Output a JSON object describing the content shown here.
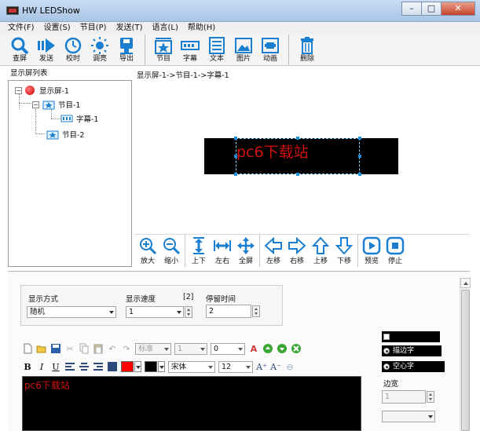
{
  "window": {
    "title": "HW LEDShow",
    "minimize": "–",
    "maximize": "□",
    "close": "✕"
  },
  "menu": [
    "文件(F)",
    "设置(S)",
    "节目(P)",
    "发送(T)",
    "语言(L)",
    "帮助(H)"
  ],
  "toolbar": {
    "groups": [
      [
        {
          "label": "查屏",
          "icon": "search-icon"
        },
        {
          "label": "发送",
          "icon": "send-icon"
        },
        {
          "label": "校时",
          "icon": "clock-icon"
        },
        {
          "label": "调亮",
          "icon": "brightness-icon"
        },
        {
          "label": "导出",
          "icon": "export-icon"
        }
      ],
      [
        {
          "label": "节目",
          "icon": "program-icon"
        },
        {
          "label": "字幕",
          "icon": "subtitle-icon"
        },
        {
          "label": "文本",
          "icon": "text-icon"
        },
        {
          "label": "图片",
          "icon": "image-icon"
        },
        {
          "label": "动画",
          "icon": "animation-icon"
        }
      ],
      [
        {
          "label": "删除",
          "icon": "delete-icon"
        }
      ]
    ]
  },
  "tree": {
    "header": "显示屏列表",
    "nodes": {
      "screen": "显示屏-1",
      "program1": "节目-1",
      "subtitle1": "字幕-1",
      "program2": "节目-2"
    }
  },
  "breadcrumb": "显示屏-1->节目-1->字幕-1",
  "preview": {
    "led_text": "pc6下载站",
    "text_color": "#d01010"
  },
  "move_toolbar": {
    "groups": [
      [
        {
          "label": "放大",
          "icon": "zoom-in-icon"
        },
        {
          "label": "缩小",
          "icon": "zoom-out-icon"
        }
      ],
      [
        {
          "label": "上下",
          "icon": "vertical-resize-icon"
        },
        {
          "label": "左右",
          "icon": "horizontal-resize-icon"
        },
        {
          "label": "全屏",
          "icon": "fullscreen-icon"
        }
      ],
      [
        {
          "label": "左移",
          "icon": "move-left-icon"
        },
        {
          "label": "右移",
          "icon": "move-right-icon"
        },
        {
          "label": "上移",
          "icon": "move-up-icon"
        },
        {
          "label": "下移",
          "icon": "move-down-icon"
        }
      ],
      [
        {
          "label": "预览",
          "icon": "preview-icon"
        },
        {
          "label": "停止",
          "icon": "stop-icon"
        }
      ]
    ]
  },
  "settings": {
    "display_mode_label": "显示方式",
    "display_mode_value": "随机",
    "speed_label": "显示速度",
    "speed_hint": "[2]",
    "speed_value": "1",
    "stay_label": "停留时间",
    "stay_value": "2"
  },
  "editor": {
    "style_combo": "标准",
    "size_combo1": "1",
    "size_combo2": "0",
    "font_name": "宋体",
    "font_size": "12",
    "fg_color": "#ff0000",
    "bg_color": "#000000",
    "content": "pc6下载站"
  },
  "side_options": {
    "stroke_label": "描边字",
    "hollow_label": "空心字",
    "border_width_label": "边宽",
    "border_width_value": "1"
  }
}
